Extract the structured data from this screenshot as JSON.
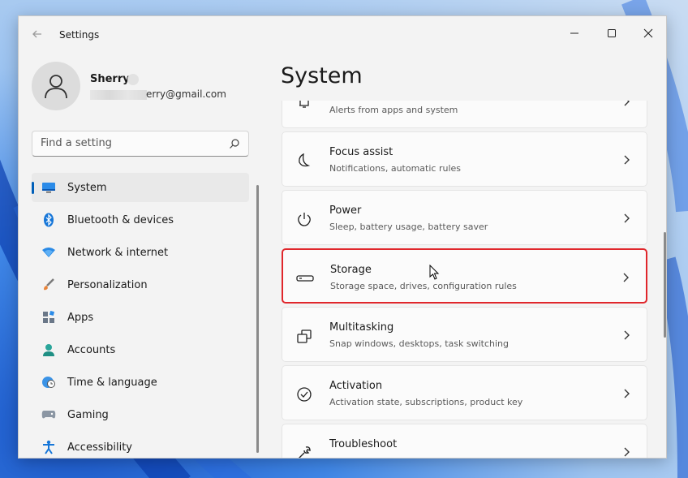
{
  "window": {
    "title": "Settings"
  },
  "profile": {
    "name": "Sherry",
    "email_visible": "erry@gmail.com"
  },
  "search": {
    "placeholder": "Find a setting"
  },
  "sidebar": {
    "items": [
      {
        "label": "System",
        "icon": "system-display-icon",
        "selected": true
      },
      {
        "label": "Bluetooth & devices",
        "icon": "bluetooth-icon"
      },
      {
        "label": "Network & internet",
        "icon": "wifi-icon"
      },
      {
        "label": "Personalization",
        "icon": "brush-icon"
      },
      {
        "label": "Apps",
        "icon": "apps-icon"
      },
      {
        "label": "Accounts",
        "icon": "accounts-icon"
      },
      {
        "label": "Time & language",
        "icon": "globe-clock-icon"
      },
      {
        "label": "Gaming",
        "icon": "gamepad-icon"
      },
      {
        "label": "Accessibility",
        "icon": "accessibility-icon"
      }
    ]
  },
  "main": {
    "title": "System",
    "cards": [
      {
        "title": "",
        "subtitle": "Alerts from apps and system",
        "icon": "bell-icon"
      },
      {
        "title": "Focus assist",
        "subtitle": "Notifications, automatic rules",
        "icon": "moon-icon"
      },
      {
        "title": "Power",
        "subtitle": "Sleep, battery usage, battery saver",
        "icon": "power-icon"
      },
      {
        "title": "Storage",
        "subtitle": "Storage space, drives, configuration rules",
        "icon": "storage-drive-icon",
        "highlighted": true
      },
      {
        "title": "Multitasking",
        "subtitle": "Snap windows, desktops, task switching",
        "icon": "multitasking-icon"
      },
      {
        "title": "Activation",
        "subtitle": "Activation state, subscriptions, product key",
        "icon": "check-circle-icon"
      },
      {
        "title": "Troubleshoot",
        "subtitle": "",
        "icon": "wrench-icon"
      }
    ]
  },
  "colors": {
    "accent": "#005fb8",
    "highlight_border": "#e0262b",
    "window_bg": "#f3f3f3",
    "card_bg": "#fbfbfb"
  }
}
